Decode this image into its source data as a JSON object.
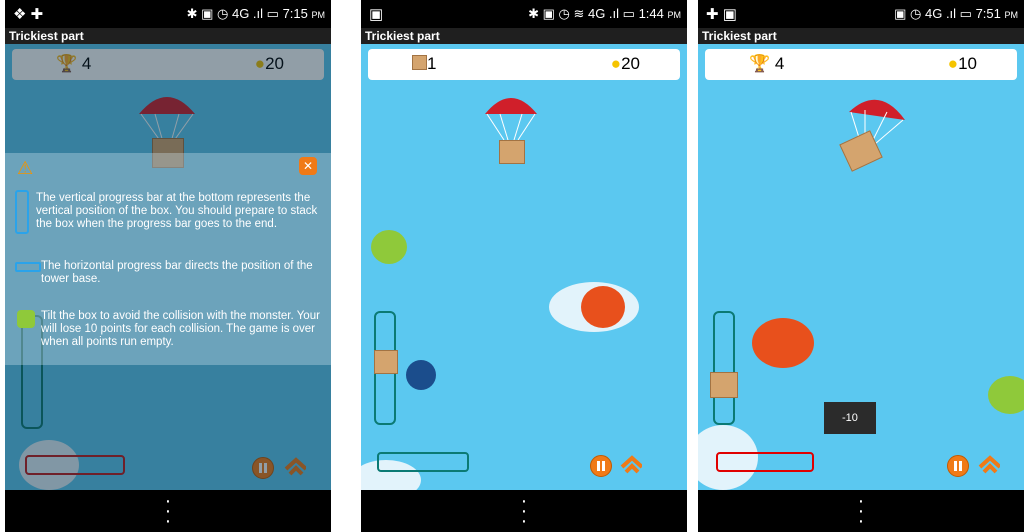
{
  "screens": [
    {
      "status": {
        "time": "7:15",
        "ampm": "PM"
      },
      "title": "Trickiest part",
      "score": {
        "left": "4",
        "right": "20"
      },
      "help": {
        "vertical": "The vertical progress bar at the bottom represents the vertical position of the box. You should prepare to stack the box when the progress bar goes to the end.",
        "horizontal": "The horizontal progress bar directs the position of the tower base.",
        "monster": "Tilt the box to avoid the collision with the monster. Your will lose 10 points for each collision. The game is over when all points run empty."
      }
    },
    {
      "status": {
        "time": "1:44",
        "ampm": "PM"
      },
      "title": "Trickiest part",
      "score": {
        "left": "1",
        "right": "20"
      }
    },
    {
      "status": {
        "time": "7:51",
        "ampm": "PM"
      },
      "title": "Trickiest part",
      "score": {
        "left": "4",
        "right": "10"
      },
      "toast": "-10"
    }
  ],
  "icons": {
    "trophy": "trophy-icon",
    "coin": "coin-icon",
    "crate": "crate-icon",
    "pause": "pause-icon",
    "home": "home-icon",
    "warning": "warning-icon",
    "close": "close-icon",
    "menu": "menu-icon"
  },
  "colors": {
    "sky": "#5bc8f0",
    "bar_outline": "#0b7a74",
    "button": "#f07a17",
    "monster_red": "#e8501c",
    "monster_green": "#8fc93a"
  }
}
